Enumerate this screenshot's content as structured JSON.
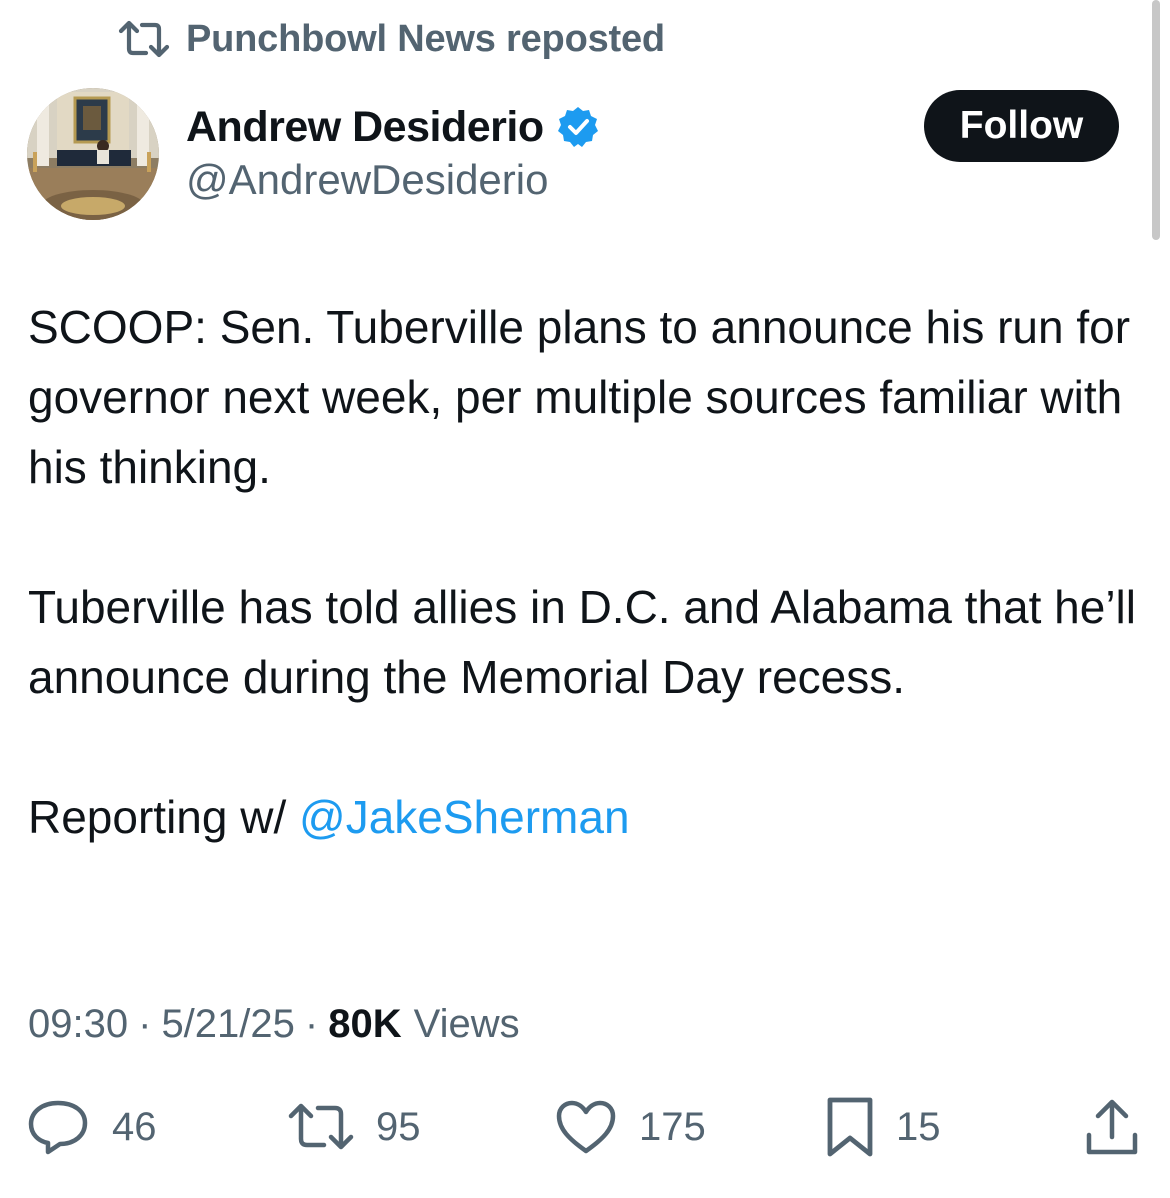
{
  "repost": {
    "label": "Punchbowl News reposted",
    "icon": "repost-icon"
  },
  "author": {
    "name": "Andrew Desiderio",
    "handle": "@AndrewDesiderio",
    "verified": true,
    "verified_color": "#1d9bf0"
  },
  "follow_button": {
    "label": "Follow"
  },
  "tweet": {
    "paragraph_1": "SCOOP: Sen. Tuberville plans to announce his run for governor next week, per multiple sources familiar with his thinking.",
    "paragraph_2": "Tuberville has told allies in D.C. and Alabama that he’ll announce during the Memorial Day recess.",
    "paragraph_3_prefix": "Reporting w/ ",
    "mention": "@JakeSherman"
  },
  "meta": {
    "time": "09:30",
    "date": "5/21/25",
    "separator": "·",
    "views_count": "80K",
    "views_label": "Views"
  },
  "actions": {
    "reply": {
      "icon": "reply-icon",
      "count": "46"
    },
    "repost": {
      "icon": "repost-icon",
      "count": "95"
    },
    "like": {
      "icon": "heart-icon",
      "count": "175"
    },
    "bookmark": {
      "icon": "bookmark-icon",
      "count": "15"
    },
    "share": {
      "icon": "share-icon"
    }
  },
  "colors": {
    "text_primary": "#0f1419",
    "text_secondary": "#536471",
    "link": "#1d9bf0",
    "follow_bg": "#0f1419"
  }
}
